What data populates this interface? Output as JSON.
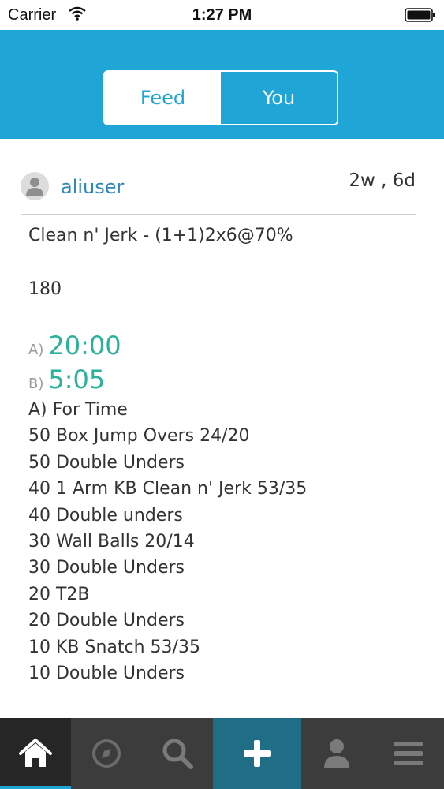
{
  "status_bar": {
    "carrier": "Carrier",
    "time": "1:27 PM"
  },
  "segmented_control": {
    "feed_label": "Feed",
    "you_label": "You",
    "selected": "Feed"
  },
  "post": {
    "username": "aliuser",
    "time_ago": "2w , 6d",
    "workout_title": "Clean n' Jerk - (1+1)2x6@70%",
    "score": "180",
    "results": [
      {
        "label": "A)",
        "value": "20:00"
      },
      {
        "label": "B)",
        "value": "5:05"
      }
    ],
    "description_lines": [
      "A) For Time",
      "50 Box Jump Overs 24/20",
      "50 Double Unders",
      "40 1 Arm KB Clean n' Jerk 53/35",
      "40 Double unders",
      "30 Wall Balls 20/14",
      "30 Double Unders",
      "20 T2B",
      "20 Double Unders",
      "10 KB Snatch 53/35",
      "10 Double Unders"
    ]
  },
  "tab_bar": {
    "active": "home",
    "icons": [
      "home-icon",
      "compass-icon",
      "search-icon",
      "plus-icon",
      "user-icon",
      "menu-icon"
    ]
  },
  "colors": {
    "header": "#1FA6D6",
    "username": "#2F86B7",
    "result_value": "#2BB29C",
    "tabbar": "#3C3C3C",
    "add_tab": "#1F6E86"
  }
}
